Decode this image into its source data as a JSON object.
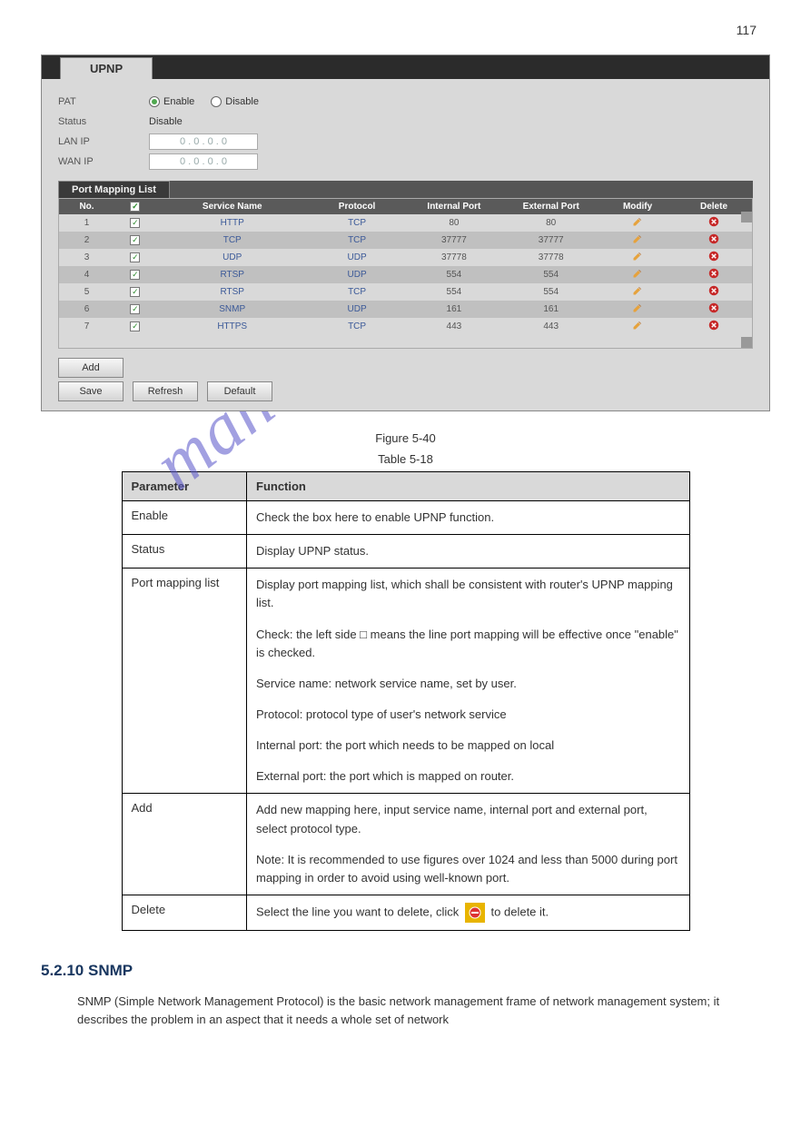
{
  "page_number_top": "117",
  "upnp": {
    "tab_label": "UPNP",
    "fields": {
      "pat_label": "PAT",
      "enable_label": "Enable",
      "disable_label": "Disable",
      "status_label": "Status",
      "status_value": "Disable",
      "lanip_label": "LAN IP",
      "wanip_label": "WAN IP",
      "ip_placeholder": "0 . 0 . 0 . 0"
    },
    "port_mapping_tab": "Port Mapping List",
    "columns": {
      "no": "No.",
      "check": "",
      "service": "Service Name",
      "protocol": "Protocol",
      "internal": "Internal Port",
      "external": "External Port",
      "modify": "Modify",
      "delete": "Delete"
    },
    "rows": [
      {
        "no": "1",
        "service": "HTTP",
        "protocol": "TCP",
        "internal": "80",
        "external": "80"
      },
      {
        "no": "2",
        "service": "TCP",
        "protocol": "TCP",
        "internal": "37777",
        "external": "37777"
      },
      {
        "no": "3",
        "service": "UDP",
        "protocol": "UDP",
        "internal": "37778",
        "external": "37778"
      },
      {
        "no": "4",
        "service": "RTSP",
        "protocol": "UDP",
        "internal": "554",
        "external": "554"
      },
      {
        "no": "5",
        "service": "RTSP",
        "protocol": "TCP",
        "internal": "554",
        "external": "554"
      },
      {
        "no": "6",
        "service": "SNMP",
        "protocol": "UDP",
        "internal": "161",
        "external": "161"
      },
      {
        "no": "7",
        "service": "HTTPS",
        "protocol": "TCP",
        "internal": "443",
        "external": "443"
      }
    ],
    "buttons": {
      "add": "Add",
      "save": "Save",
      "refresh": "Refresh",
      "default": "Default"
    }
  },
  "figure_caption": "Figure 5-40",
  "table_caption": "Table 5-18",
  "param_table": {
    "hdr_parameter": "Parameter",
    "hdr_function": "Function",
    "rows": [
      {
        "param": "Enable",
        "func": [
          "Check the box here to enable UPNP function."
        ]
      },
      {
        "param": "Status",
        "func": [
          "Display UPNP status."
        ]
      },
      {
        "param": "Port mapping list",
        "func": [
          "Display port mapping list, which shall be consistent with router's UPNP mapping list.",
          "Check: the left side □ means the line port mapping will be effective once \"enable\" is checked.",
          "Service name: network service name, set by user.",
          "Protocol: protocol type of user's network service",
          "Internal port: the port which needs to be mapped on local",
          "External port: the port which is mapped on router."
        ]
      },
      {
        "param": "Add",
        "func": [
          "Add new mapping here, input service name, internal port and external port, select protocol type.",
          "Note: It is recommended to use figures over 1024 and less than 5000 during port mapping in order to avoid using well-known port."
        ]
      },
      {
        "param": "Delete",
        "func_pre": "Select the line you want to delete, click ",
        "func_post": " to delete it."
      }
    ]
  },
  "section": {
    "heading": "5.2.10 SNMP",
    "body1": "SNMP (Simple Network Management Protocol) is the basic network management frame of network management system; it describes the problem in an aspect that it needs a whole set of network"
  },
  "watermark": "manualshive.com"
}
